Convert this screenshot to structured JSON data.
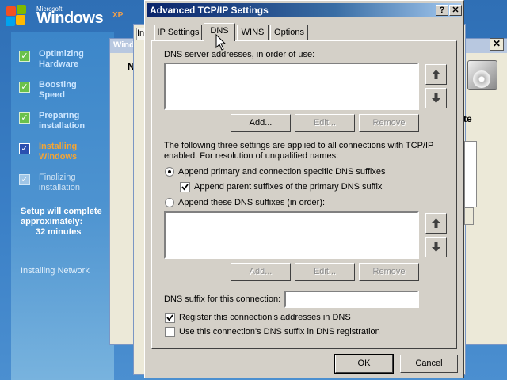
{
  "setup": {
    "logo_small": "Microsoft",
    "logo_word": "Windows",
    "logo_ver": "XP",
    "steps": [
      {
        "label": "Optimizing Hardware",
        "state": "done"
      },
      {
        "label": "Boosting Speed",
        "state": "done"
      },
      {
        "label": "Preparing installation",
        "state": "done"
      },
      {
        "label": "Installing Windows",
        "state": "current"
      },
      {
        "label": "Finalizing installation",
        "state": "pending"
      }
    ],
    "eta_line1": "Setup will complete",
    "eta_line2": "approximately:",
    "eta_minutes": "32 minutes",
    "status": "Installing Network",
    "background_window_title": "Wind",
    "background_window_letter": "N",
    "right_text": "te",
    "inner_tab_letter": "In"
  },
  "dialog": {
    "title": "Advanced TCP/IP Settings",
    "help_button": "?",
    "close_button": "✕",
    "tabs": [
      {
        "label": "IP Settings",
        "active": false
      },
      {
        "label": "DNS",
        "active": true
      },
      {
        "label": "WINS",
        "active": false
      },
      {
        "label": "Options",
        "active": false
      }
    ],
    "dns_servers_label": "DNS server addresses, in order of use:",
    "dns_servers": [],
    "buttons_top": {
      "add": "Add...",
      "edit": "Edit...",
      "remove": "Remove"
    },
    "info_text_1": "The following three settings are applied to all connections with TCP/IP",
    "info_text_2": "enabled. For resolution of unqualified names:",
    "radio_primary": {
      "label": "Append primary and connection specific DNS suffixes",
      "selected": true
    },
    "check_parent": {
      "label": "Append parent suffixes of the primary DNS suffix",
      "checked": true
    },
    "radio_these": {
      "label": "Append these DNS suffixes (in order):",
      "selected": false
    },
    "suffix_list": [],
    "buttons_bottom": {
      "add": "Add...",
      "edit": "Edit...",
      "remove": "Remove"
    },
    "suffix_label": "DNS suffix for this connection:",
    "suffix_value": "",
    "check_register": {
      "label": "Register this connection's addresses in DNS",
      "checked": true
    },
    "check_use_suffix": {
      "label": "Use this connection's DNS suffix in DNS registration",
      "checked": false
    },
    "ok": "OK",
    "cancel": "Cancel"
  },
  "colors": {
    "title_bar": "#0a246a",
    "accent_orange": "#f4a534",
    "check_green": "#6ac14b"
  }
}
